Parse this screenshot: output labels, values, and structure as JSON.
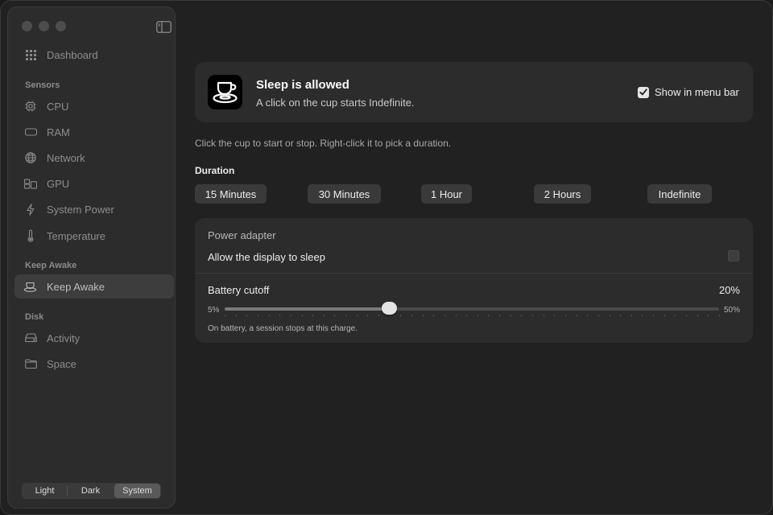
{
  "sidebar": {
    "dashboard": "Dashboard",
    "sections": {
      "sensors": "Sensors",
      "keep_awake": "Keep Awake",
      "disk": "Disk"
    },
    "items": {
      "cpu": "CPU",
      "ram": "RAM",
      "network": "Network",
      "gpu": "GPU",
      "system_power": "System Power",
      "temperature": "Temperature",
      "keep_awake": "Keep Awake",
      "activity": "Activity",
      "space": "Space"
    },
    "appearance": {
      "options": [
        "Light",
        "Dark",
        "System"
      ],
      "selected": "System"
    }
  },
  "status": {
    "title": "Sleep is allowed",
    "subtitle": "A click on the cup starts Indefinite.",
    "show_in_menu_bar": "Show in menu bar",
    "show_in_menu_bar_checked": true
  },
  "hint": "Click the cup to start or stop. Right-click it to pick a duration.",
  "duration": {
    "label": "Duration",
    "options": [
      "15 Minutes",
      "30 Minutes",
      "1 Hour",
      "2 Hours",
      "Indefinite"
    ]
  },
  "power": {
    "adapter_label": "Power adapter",
    "allow_display_sleep": "Allow the display to sleep",
    "allow_display_sleep_checked": false,
    "battery_cutoff_label": "Battery cutoff",
    "battery_cutoff_value": "20%",
    "slider": {
      "min_label": "5%",
      "max_label": "50%",
      "min": 5,
      "max": 50,
      "value": 20
    },
    "hint": "On battery, a session stops at this charge."
  }
}
